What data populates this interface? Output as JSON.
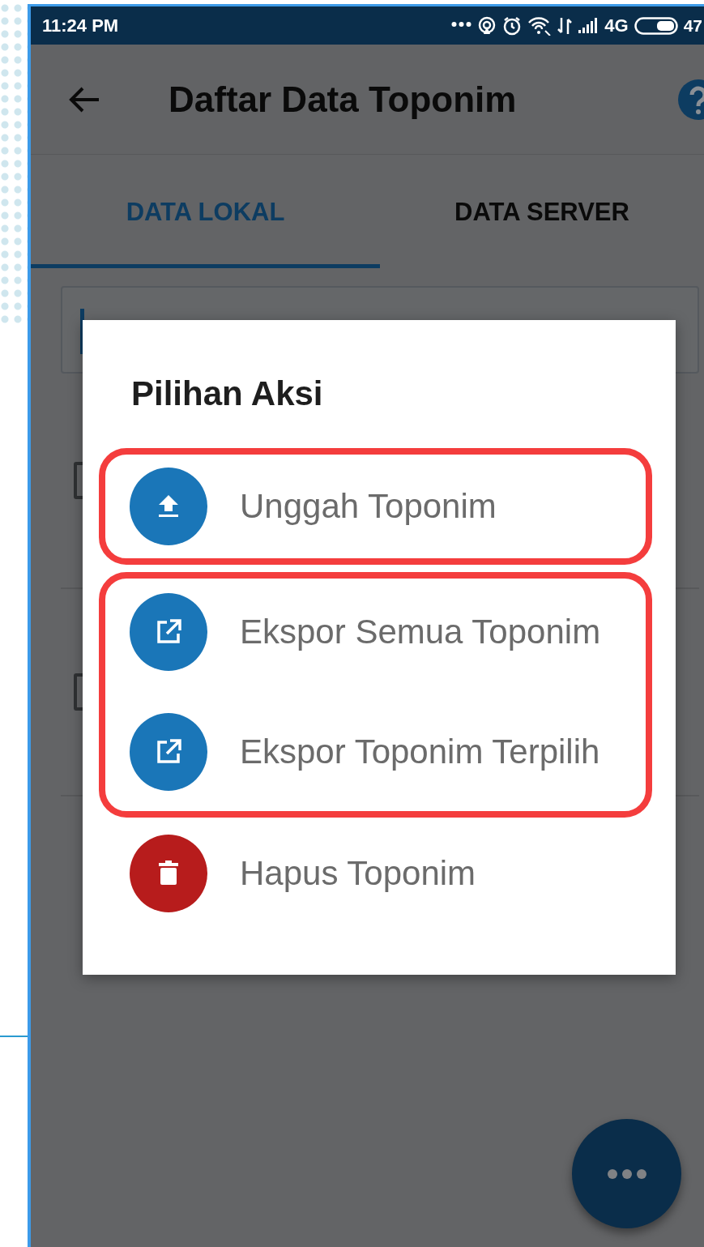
{
  "status_bar": {
    "time": "11:24 PM",
    "network": "4G",
    "battery": "47"
  },
  "app_bar": {
    "title": "Daftar Data Toponim"
  },
  "tabs": [
    {
      "label": "DATA LOKAL",
      "selected": true
    },
    {
      "label": "DATA SERVER",
      "selected": false
    }
  ],
  "list": {
    "rows": [
      {
        "checked": false
      },
      {
        "checked": false
      }
    ]
  },
  "dialog": {
    "title": "Pilihan Aksi",
    "groups": [
      {
        "highlighted": true,
        "items": [
          {
            "kind": "upload",
            "label": "Unggah Toponim"
          }
        ]
      },
      {
        "highlighted": true,
        "items": [
          {
            "kind": "export",
            "label": "Ekspor Semua Toponim"
          },
          {
            "kind": "export",
            "label": "Ekspor Toponim Terpilih"
          }
        ]
      },
      {
        "highlighted": false,
        "items": [
          {
            "kind": "delete",
            "label": "Hapus Toponim"
          }
        ]
      }
    ]
  }
}
